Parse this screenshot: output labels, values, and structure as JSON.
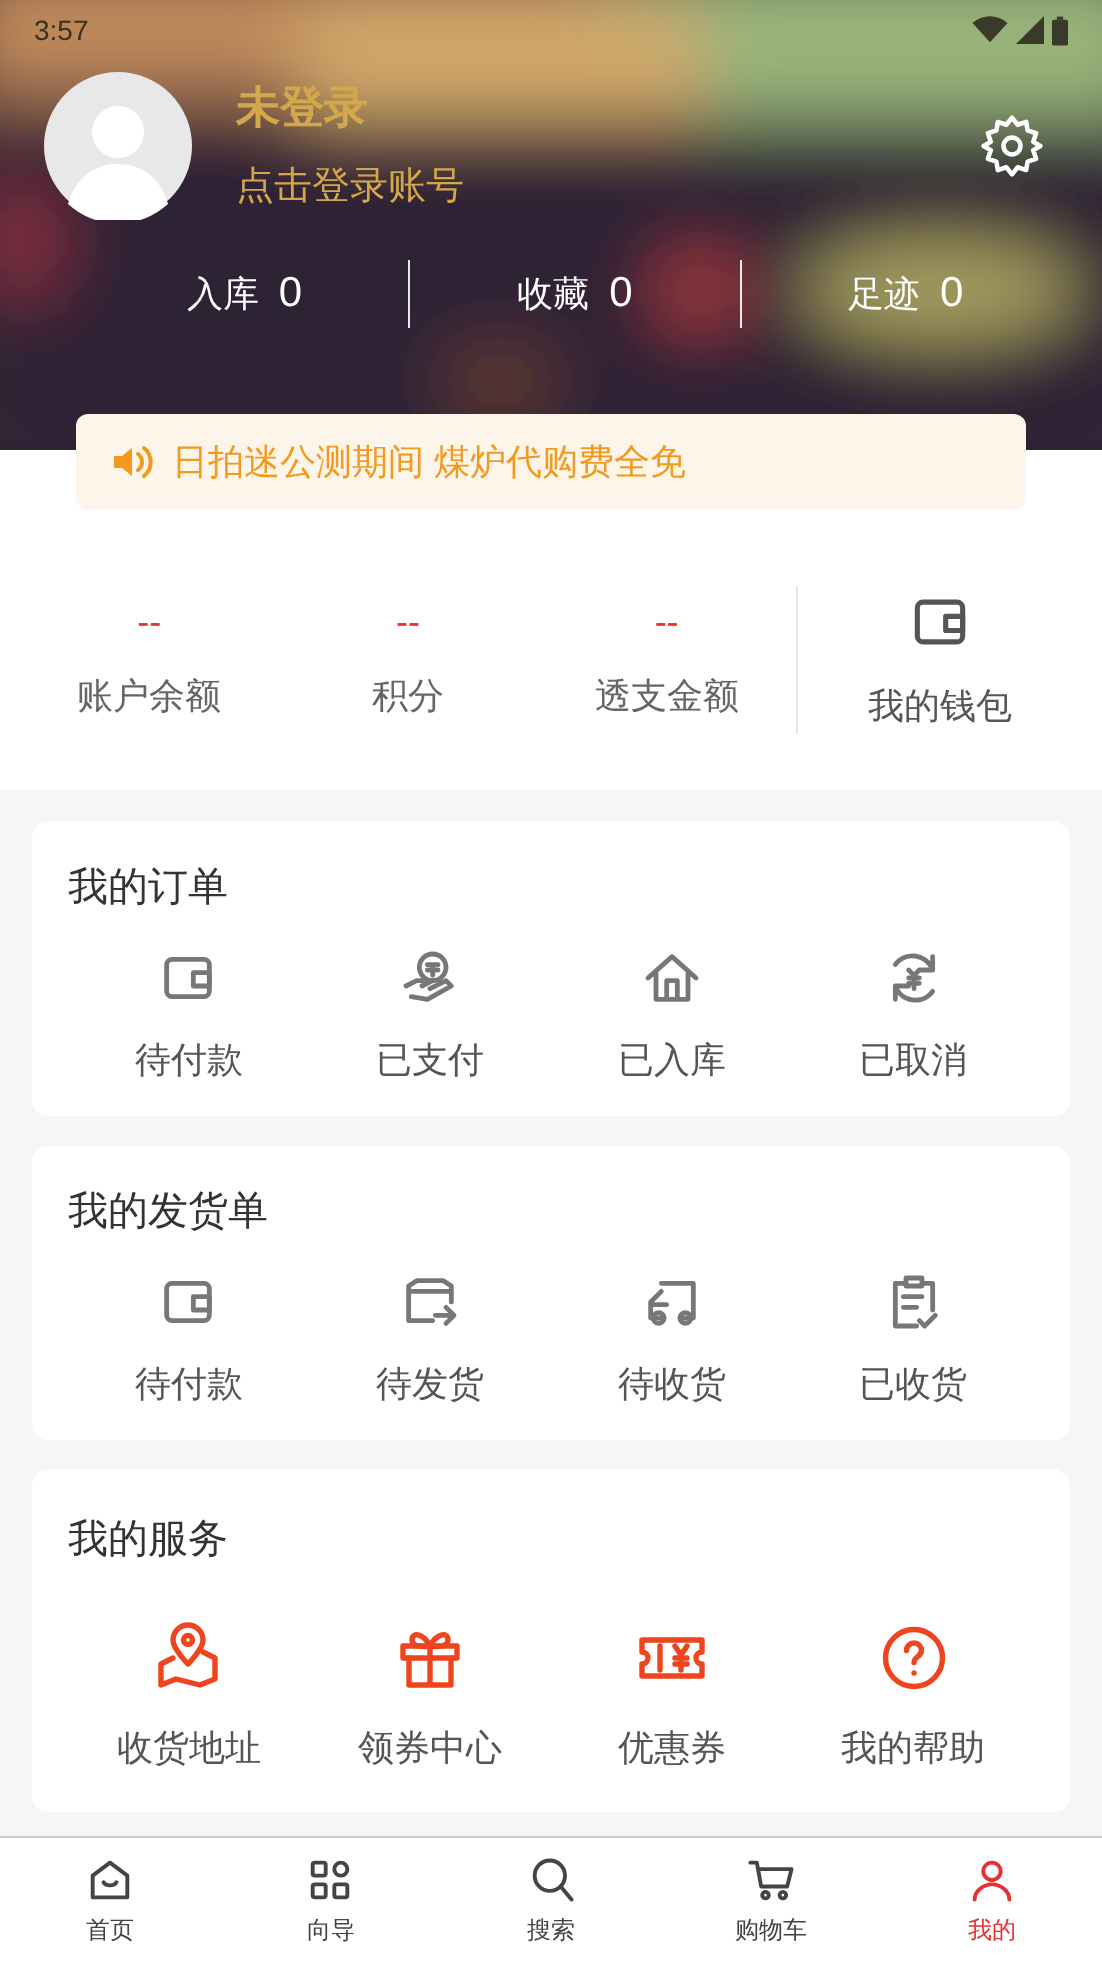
{
  "status_bar": {
    "time": "3:57"
  },
  "profile": {
    "name": "未登录",
    "subtitle": "点击登录账号"
  },
  "counters": [
    {
      "label": "入库",
      "value": "0"
    },
    {
      "label": "收藏",
      "value": "0"
    },
    {
      "label": "足迹",
      "value": "0"
    }
  ],
  "notice": "日拍迷公测期间 煤炉代购费全免",
  "wallet": {
    "stats": [
      {
        "value": "--",
        "label": "账户余额"
      },
      {
        "value": "--",
        "label": "积分"
      },
      {
        "value": "--",
        "label": "透支金额"
      }
    ],
    "link": "我的钱包"
  },
  "sections": [
    {
      "title": "我的订单",
      "kind": "status",
      "items": [
        {
          "label": "待付款",
          "kind": "wallet"
        },
        {
          "label": "已支付",
          "kind": "pay"
        },
        {
          "label": "已入库",
          "kind": "house"
        },
        {
          "label": "已取消",
          "kind": "refund"
        }
      ]
    },
    {
      "title": "我的发货单",
      "kind": "status",
      "items": [
        {
          "label": "待付款",
          "kind": "wallet"
        },
        {
          "label": "待发货",
          "kind": "ship"
        },
        {
          "label": "待收货",
          "kind": "truck"
        },
        {
          "label": "已收货",
          "kind": "clipboard"
        }
      ]
    },
    {
      "title": "我的服务",
      "kind": "service",
      "items": [
        {
          "label": "收货地址",
          "kind": "map"
        },
        {
          "label": "领券中心",
          "kind": "gift"
        },
        {
          "label": "优惠券",
          "kind": "coupon"
        },
        {
          "label": "我的帮助",
          "kind": "help"
        }
      ]
    }
  ],
  "tab_bar": [
    {
      "label": "首页",
      "kind": "home",
      "selected": false
    },
    {
      "label": "向导",
      "kind": "grid",
      "selected": false
    },
    {
      "label": "搜索",
      "kind": "search",
      "selected": false
    },
    {
      "label": "购物车",
      "kind": "cart",
      "selected": false
    },
    {
      "label": "我的",
      "kind": "user",
      "selected": true
    }
  ]
}
